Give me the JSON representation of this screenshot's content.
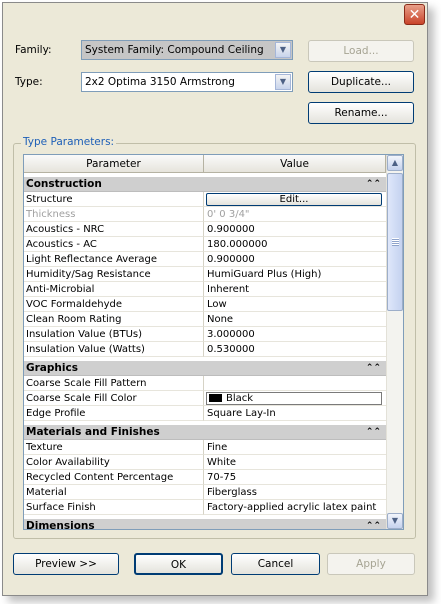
{
  "dialog": {
    "close_glyph": "✕",
    "family": {
      "label": "Family:",
      "value": "System Family: Compound Ceiling",
      "load_label": "Load..."
    },
    "type": {
      "label": "Type:",
      "value": "2x2 Optima 3150 Armstrong",
      "duplicate_label": "Duplicate...",
      "rename_label": "Rename..."
    },
    "type_parameters": {
      "group_label": "Type Parameters:",
      "columns": [
        "Parameter",
        "Value"
      ],
      "sections": [
        {
          "title": "Construction",
          "rows": [
            {
              "param": "Structure",
              "value": "Edit..."
            },
            {
              "param": "Thickness",
              "value": "0'  0 3/4\""
            },
            {
              "param": "Acoustics - NRC",
              "value": "0.900000"
            },
            {
              "param": "Acoustics - AC",
              "value": "180.000000"
            },
            {
              "param": "Light Reflectance Average",
              "value": "0.900000"
            },
            {
              "param": "Humidity/Sag Resistance",
              "value": "HumiGuard Plus (High)"
            },
            {
              "param": "Anti-Microbial",
              "value": "Inherent"
            },
            {
              "param": "VOC Formaldehyde",
              "value": "Low"
            },
            {
              "param": "Clean Room Rating",
              "value": "None"
            },
            {
              "param": "Insulation Value (BTUs)",
              "value": "3.000000"
            },
            {
              "param": "Insulation Value (Watts)",
              "value": "0.530000"
            }
          ]
        },
        {
          "title": "Graphics",
          "rows": [
            {
              "param": "Coarse Scale Fill Pattern",
              "value": ""
            },
            {
              "param": "Coarse Scale Fill Color",
              "value": "Black"
            },
            {
              "param": "Edge Profile",
              "value": "Square Lay-In"
            }
          ]
        },
        {
          "title": "Materials and Finishes",
          "rows": [
            {
              "param": "Texture",
              "value": "Fine"
            },
            {
              "param": "Color Availability",
              "value": "White"
            },
            {
              "param": "Recycled Content Percentage",
              "value": "70-75"
            },
            {
              "param": "Material",
              "value": "Fiberglass"
            },
            {
              "param": "Surface Finish",
              "value": "Factory-applied acrylic latex paint"
            }
          ]
        },
        {
          "title": "Dimensions",
          "rows": []
        }
      ],
      "collapse_glyph": "⌃⌃"
    },
    "buttons": {
      "preview": "Preview >>",
      "ok": "OK",
      "cancel": "Cancel",
      "apply": "Apply"
    },
    "colors": {
      "fill_color_swatch": "#000000",
      "section_bg": "#cfcfcf",
      "dialog_bg": "#ece9d8",
      "group_label": "#1d5fb7"
    }
  }
}
